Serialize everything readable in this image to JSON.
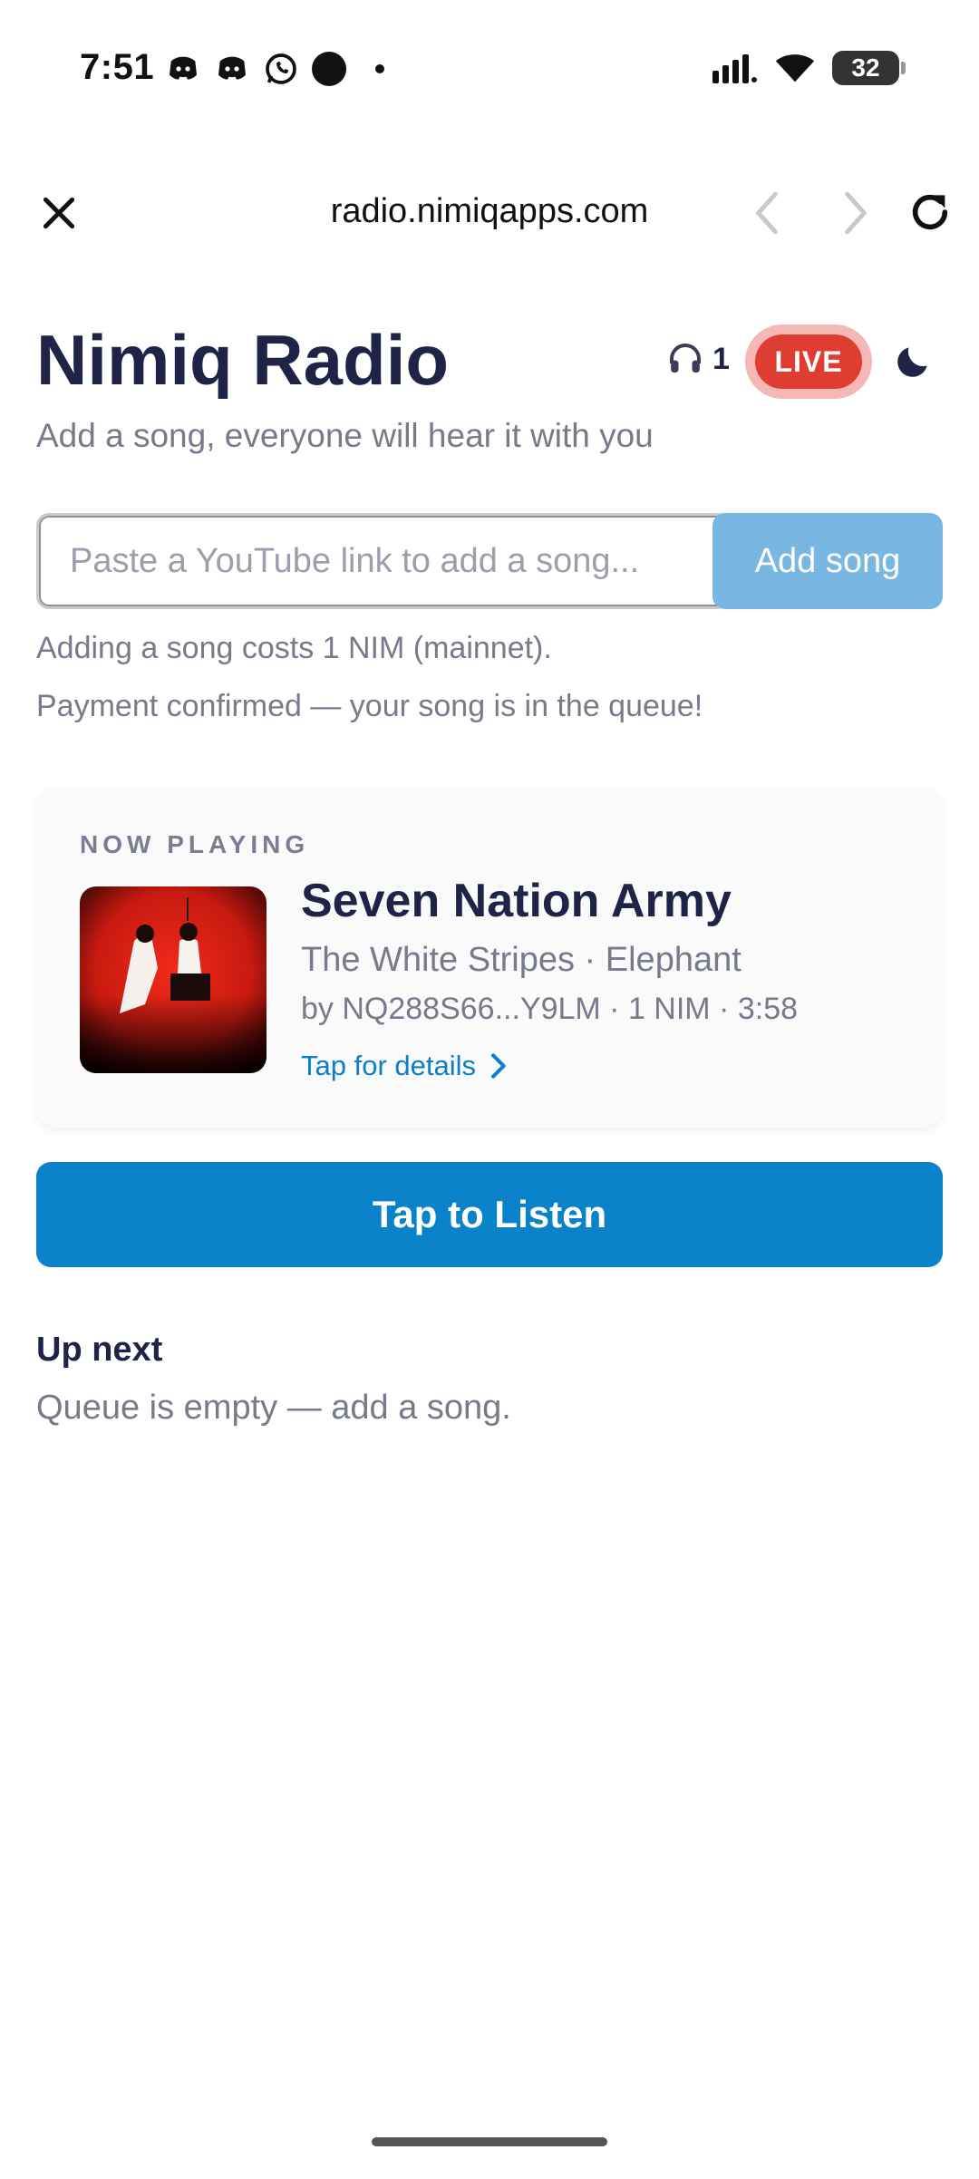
{
  "status_bar": {
    "time": "7:51",
    "battery": "32",
    "icons": [
      "discord-icon",
      "discord-icon",
      "whatsapp-icon",
      "circle-icon",
      "dot-icon",
      "signal-icon",
      "wifi-icon",
      "battery-icon"
    ]
  },
  "browser": {
    "url": "radio.nimiqapps.com"
  },
  "header": {
    "title": "Nimiq Radio",
    "listeners": "1",
    "live_label": "LIVE",
    "subtitle": "Add a song, everyone will hear it with you"
  },
  "add_song": {
    "placeholder": "Paste a YouTube link to add a song...",
    "value": "",
    "button_label": "Add song",
    "cost_note": "Adding a song costs 1 NIM (mainnet).",
    "status_note": "Payment confirmed — your song is in the queue!"
  },
  "now_playing": {
    "label": "NOW PLAYING",
    "title": "Seven Nation Army",
    "artist_album": "The White Stripes · Elephant",
    "meta": "by NQ288S66...Y9LM · 1 NIM · 3:58",
    "details_link": "Tap for details"
  },
  "listen_button": "Tap to Listen",
  "up_next": {
    "heading": "Up next",
    "empty_text": "Queue is empty — add a song."
  },
  "colors": {
    "primary_blue": "#0a82c9",
    "live_red": "#df3d32",
    "title_navy": "#1f2348",
    "muted_text": "#777a8b"
  }
}
